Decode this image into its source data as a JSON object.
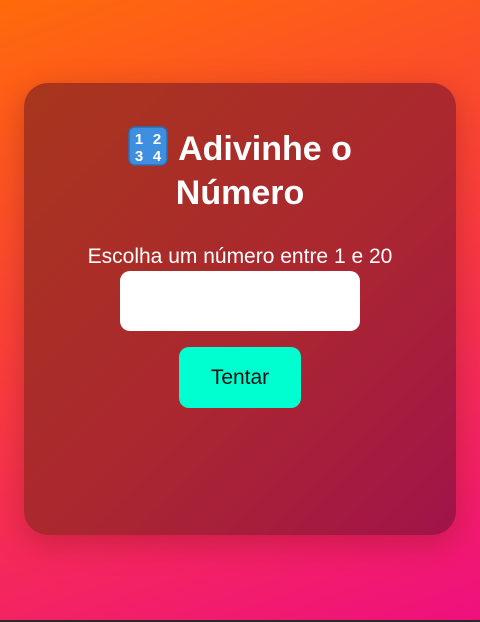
{
  "game": {
    "title_icon": "input-numbers-icon",
    "title_line1": "Adivinhe o",
    "title_line2": "Número",
    "instruction": "Escolha um número entre 1 e 20",
    "guess_value": "",
    "guess_placeholder": "",
    "try_button_label": "Tentar"
  },
  "colors": {
    "background_start": "#ff6a0a",
    "background_end": "#ef107e",
    "card_start": "#a8361d",
    "card_end": "#a1134a",
    "button": "#00ffd0",
    "icon_blue": "#3f8fe0"
  }
}
